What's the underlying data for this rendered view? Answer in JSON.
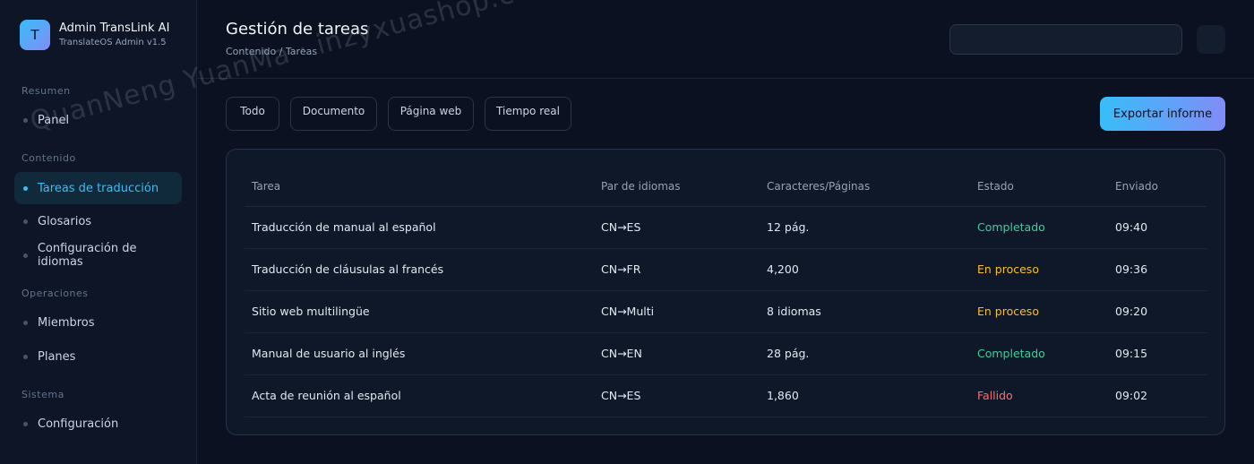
{
  "brand": {
    "logo_letter": "T",
    "name": "Admin TransLink AI",
    "subtitle": "TranslateOS Admin v1.5"
  },
  "sidebar": {
    "sections": [
      {
        "label": "Resumen",
        "items": [
          {
            "label": "Panel"
          }
        ]
      },
      {
        "label": "Contenido",
        "items": [
          {
            "label": "Tareas de traducción",
            "active": true
          },
          {
            "label": "Glosarios"
          },
          {
            "label": "Configuración de idiomas"
          }
        ]
      },
      {
        "label": "Operaciones",
        "items": [
          {
            "label": "Miembros"
          },
          {
            "label": "Planes"
          }
        ]
      },
      {
        "label": "Sistema",
        "items": [
          {
            "label": "Configuración"
          }
        ]
      }
    ]
  },
  "header": {
    "title": "Gestión de tareas",
    "breadcrumb": "Contenido / Tareas",
    "search_placeholder": ""
  },
  "filters": {
    "tabs": [
      "Todo",
      "Documento",
      "Página web",
      "Tiempo real"
    ],
    "export_label": "Exportar informe"
  },
  "table": {
    "columns": [
      "Tarea",
      "Par de idiomas",
      "Caracteres/Páginas",
      "Estado",
      "Enviado"
    ],
    "rows": [
      {
        "task": "Traducción de manual al español",
        "pair": "CN→ES",
        "size": "12 pág.",
        "status": "Completado",
        "status_kind": "done",
        "sent": "09:40"
      },
      {
        "task": "Traducción de cláusulas al francés",
        "pair": "CN→FR",
        "size": "4,200",
        "status": "En proceso",
        "status_kind": "prog",
        "sent": "09:36"
      },
      {
        "task": "Sitio web multilingüe",
        "pair": "CN→Multi",
        "size": "8 idiomas",
        "status": "En proceso",
        "status_kind": "prog",
        "sent": "09:20"
      },
      {
        "task": "Manual de usuario al inglés",
        "pair": "CN→EN",
        "size": "28 pág.",
        "status": "Completado",
        "status_kind": "done",
        "sent": "09:15"
      },
      {
        "task": "Acta de reunión al español",
        "pair": "CN→ES",
        "size": "1,860",
        "status": "Fallido",
        "status_kind": "fail",
        "sent": "09:02"
      }
    ]
  },
  "watermark": "QuanNeng YuanMa · inzyxuashop.com",
  "colors": {
    "accent": "#38bdf8",
    "accent_end": "#818cf8",
    "done": "#34d399",
    "progress": "#fbbf24",
    "failed": "#f87171"
  }
}
